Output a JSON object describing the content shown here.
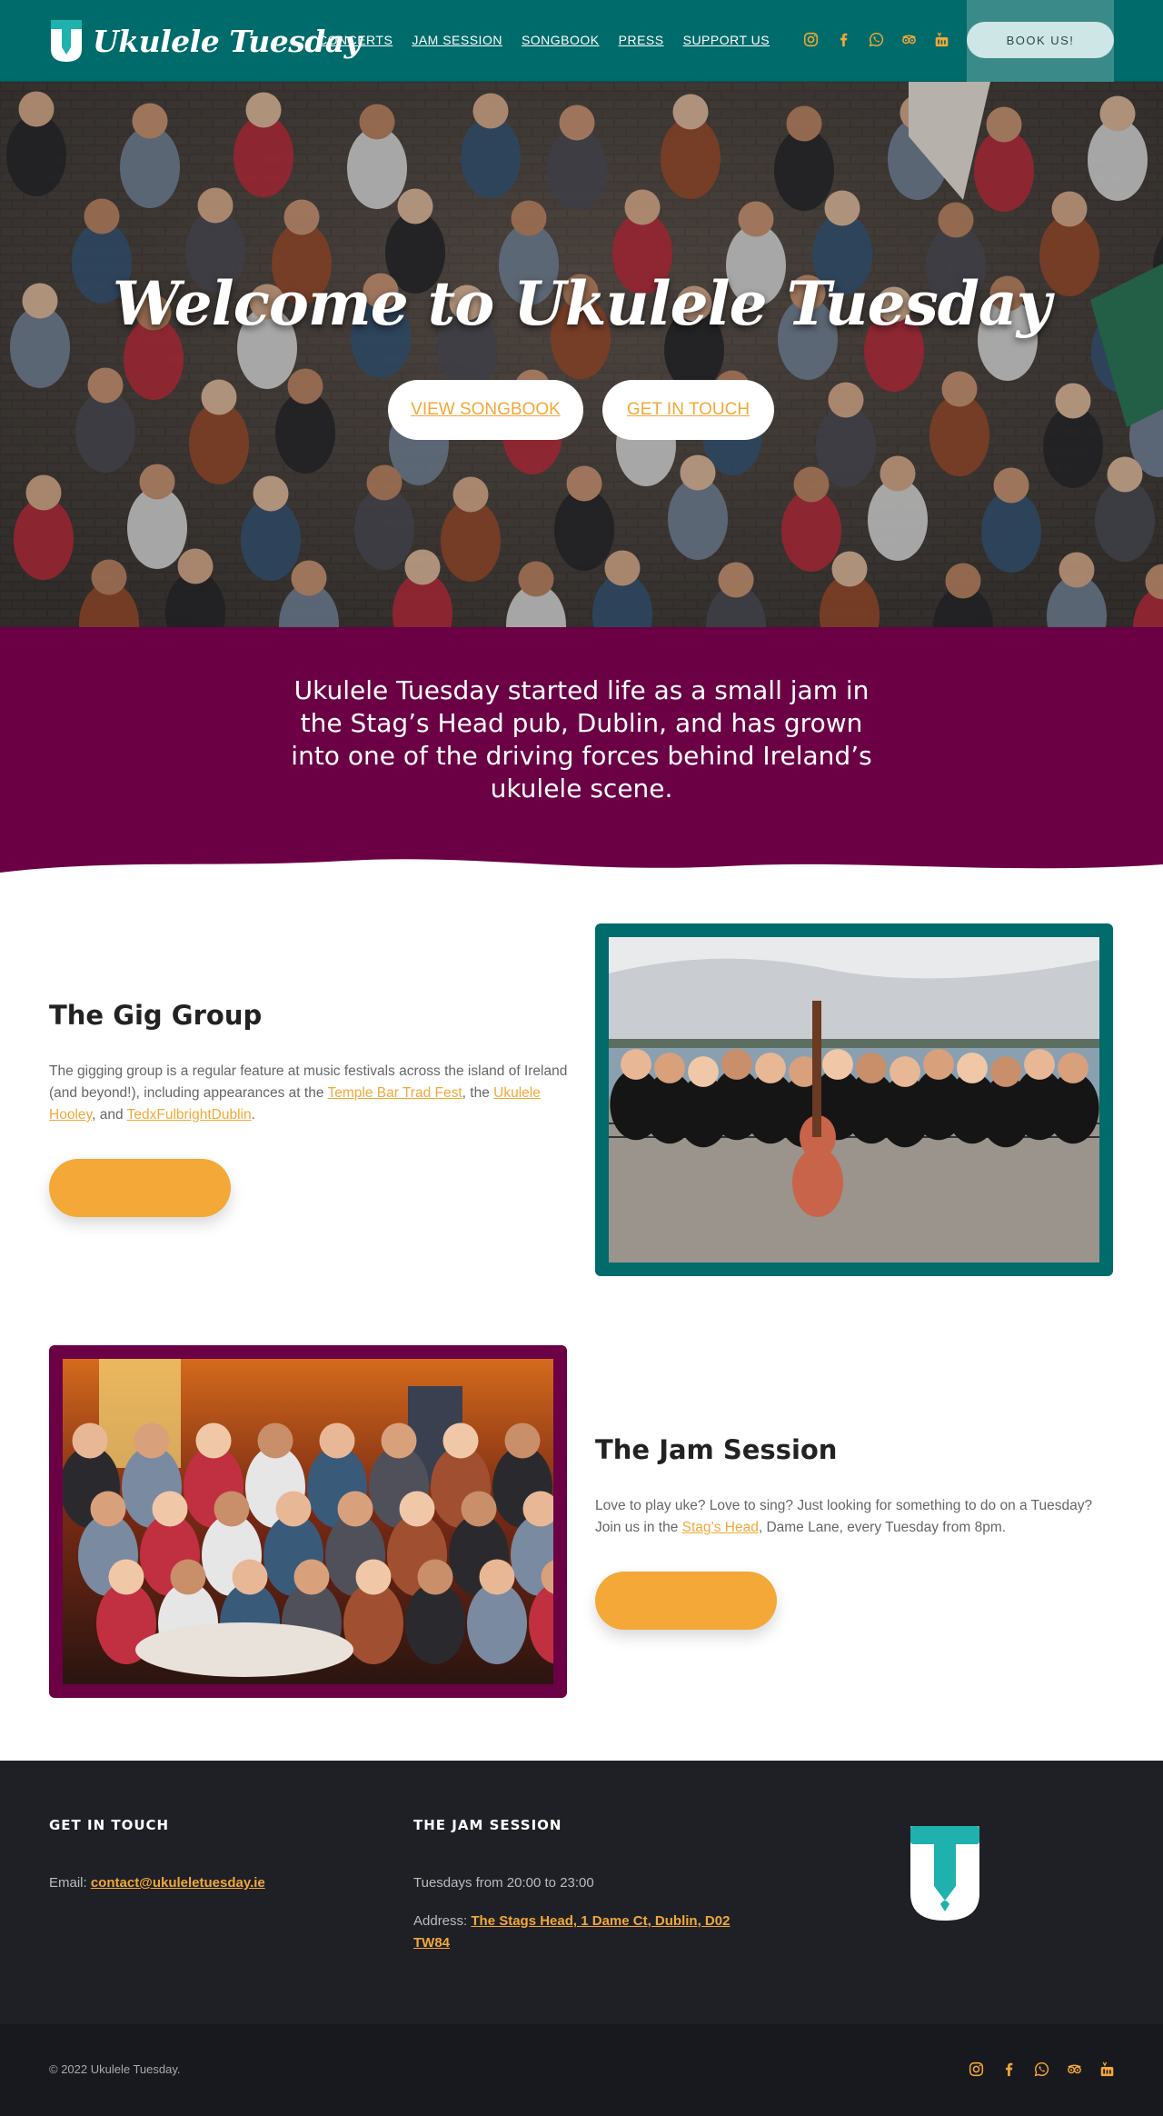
{
  "header": {
    "logo_text": "Ukulele Tuesday",
    "nav": [
      "CONCERTS",
      "JAM SESSION",
      "SONGBOOK",
      "PRESS",
      "SUPPORT US"
    ],
    "social_icons": [
      "instagram-icon",
      "facebook-icon",
      "whatsapp-icon",
      "tripadvisor-icon",
      "youtube-icon"
    ],
    "book_label": "BOOK US!"
  },
  "hero": {
    "title": "Welcome to Ukulele Tuesday",
    "btn_songbook": "VIEW SONGBOOK",
    "btn_contact": "GET IN TOUCH"
  },
  "intro": {
    "text": "Ukulele Tuesday started life as a small jam in the Stag’s Head pub, Dublin, and has grown into one of the driving forces behind Ireland’s ukulele scene."
  },
  "gig": {
    "title": "The Gig Group",
    "body_1": "The gigging group is a regular feature at music festivals across the island of Ireland (and beyond!), including appearances at the ",
    "link_1": "Temple Bar Trad Fest",
    "body_2": ", the ",
    "link_2": "Ukulele Hooley",
    "body_3": ", and ",
    "link_3": "TedxFulbrightDublin",
    "body_4": "."
  },
  "jam": {
    "title": "The Jam Session",
    "body_1": "Love to play uke? Love to sing? Just looking for something to do on a Tuesday? Join us in the ",
    "link_1": "Stag’s Head",
    "body_2": ", Dame Lane, every Tuesday from 8pm."
  },
  "footer": {
    "col1_head": "GET IN TOUCH",
    "email_label": "Email: ",
    "email": "contact@ukuleletuesday.ie",
    "col2_head": "THE JAM SESSION",
    "hours": "Tuesdays from 20:00 to 23:00",
    "address_label": "Address: ",
    "address": "The Stags Head, 1 Dame Ct, Dublin, D02 TW84",
    "copyright": "© 2022 Ukulele Tuesday."
  },
  "colors": {
    "teal": "#006b6b",
    "plum": "#6b0045",
    "orange": "#f3a838",
    "footer": "#1e2026"
  }
}
